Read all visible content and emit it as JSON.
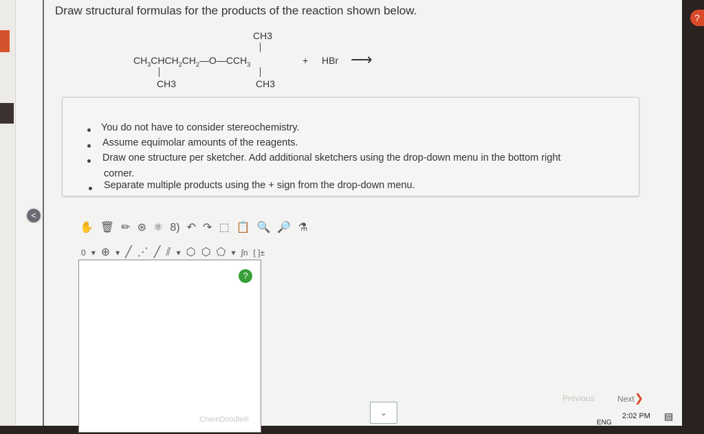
{
  "question": {
    "title": "Draw structural formulas for the products of the reaction shown below."
  },
  "reaction": {
    "top_methyl": "CH3",
    "main_chain_parts": [
      "CH",
      "3",
      "CHCH",
      "2",
      "CH",
      "2"
    ],
    "ether_o": "—O—",
    "right_carbon": "CCH",
    "right_sub": "3",
    "plus": "+",
    "reagent": "HBr",
    "arrow": "⟶",
    "bottom_left_methyl": "CH3",
    "bottom_right_methyl": "CH3"
  },
  "instructions": [
    "You do not have to consider stereochemistry.",
    "Assume equimolar amounts of the reagents.",
    "Draw one structure per sketcher. Add additional sketchers using the drop-down menu in the bottom right",
    "corner.",
    "Separate multiple products using the + sign from the drop-down menu."
  ],
  "toolbar_row1": [
    "✋",
    "🗑",
    "✏",
    "⊛",
    "⚛",
    "8)",
    "↶",
    "↷",
    "⬚",
    "📋",
    "🔍",
    "🔎",
    "⚗"
  ],
  "toolbar_row2": [
    "0",
    "▾",
    "⊕",
    "▾",
    "╱",
    "⋰",
    "╱",
    "⫽",
    "▾",
    "⬡",
    "⬡",
    "⬠",
    "▾",
    "∫n",
    "[ ]±"
  ],
  "canvas": {
    "help": "?"
  },
  "nav": {
    "previous": "Previous",
    "next": "Next",
    "next_chevron": "❯",
    "dropdown_icon": "⌄"
  },
  "os": {
    "help": "?",
    "back": "<",
    "clock": "2:02 PM",
    "lang": "ENG",
    "watermark": "ChemDoodle®"
  }
}
